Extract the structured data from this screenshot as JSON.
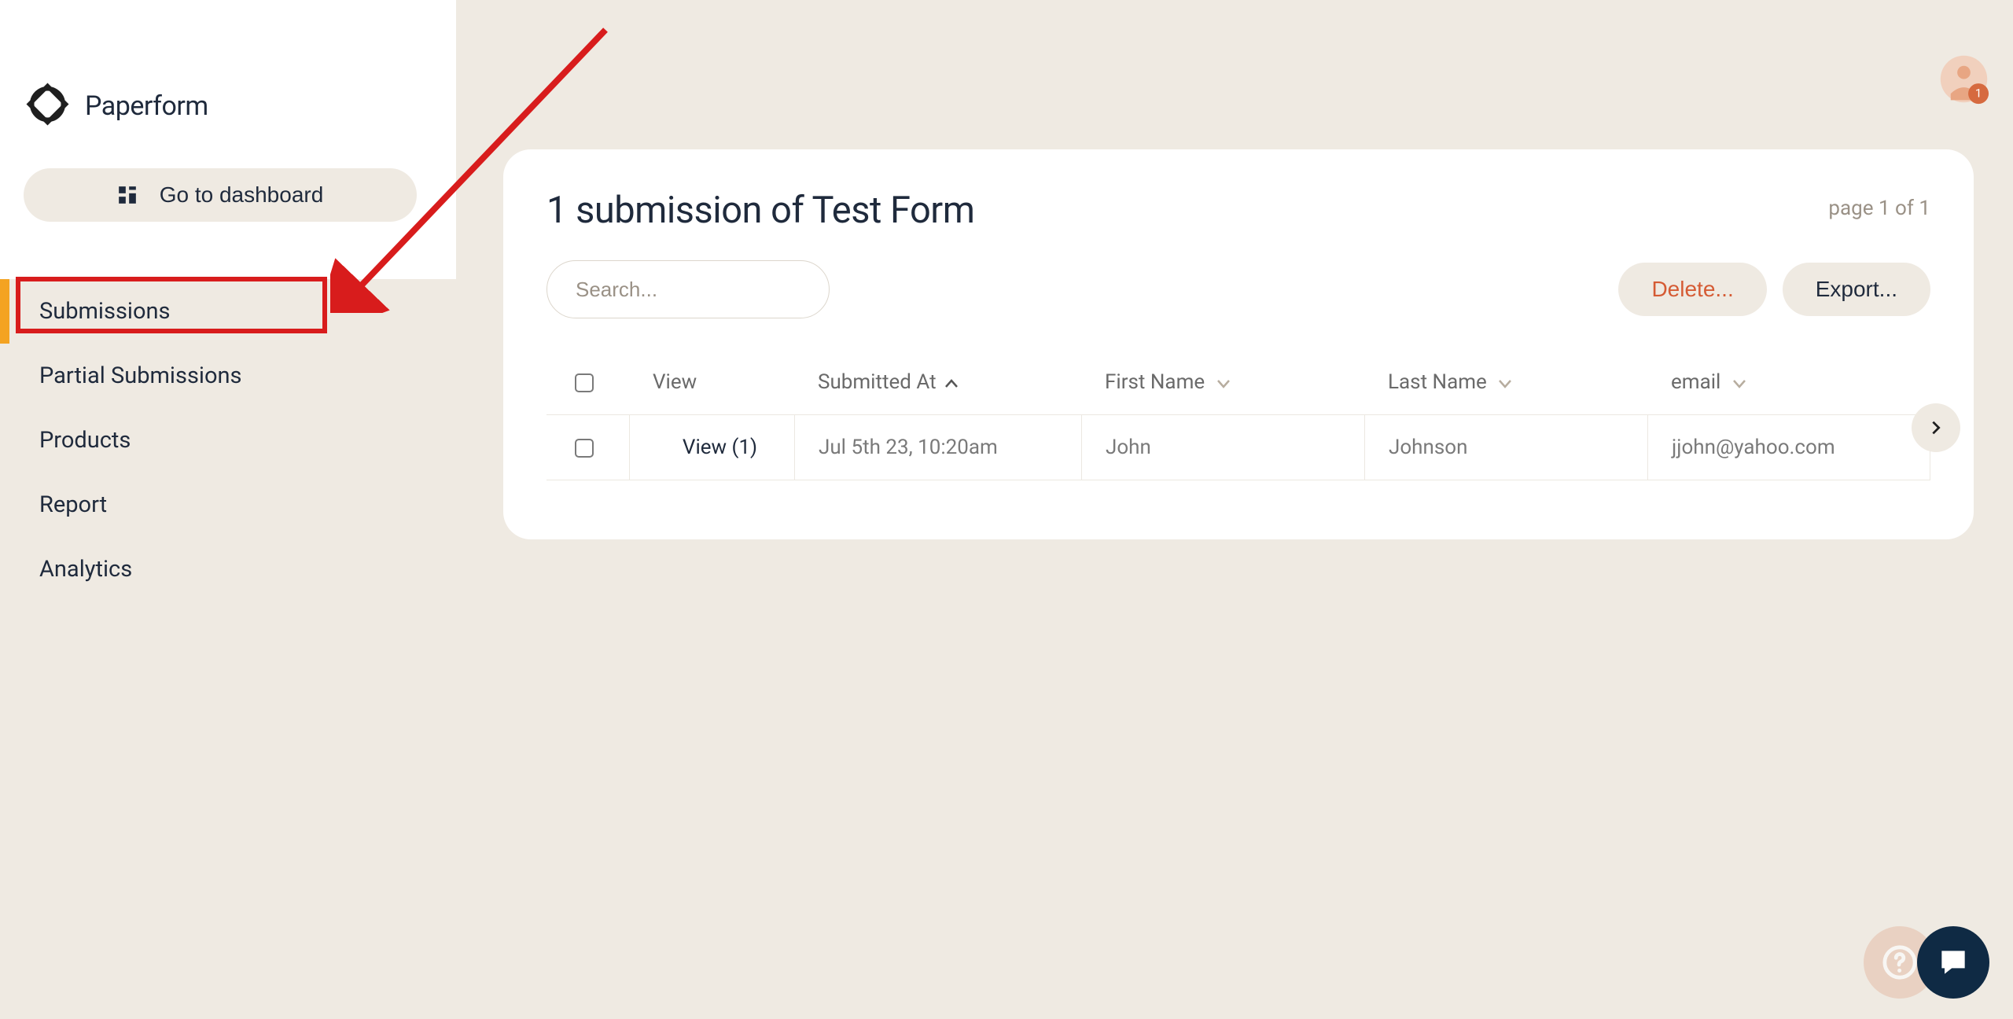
{
  "brand": {
    "name": "Paperform"
  },
  "sidebar": {
    "dashboard_label": "Go to dashboard",
    "items": [
      {
        "label": "Submissions",
        "active": true
      },
      {
        "label": "Partial Submissions",
        "active": false
      },
      {
        "label": "Products",
        "active": false
      },
      {
        "label": "Report",
        "active": false
      },
      {
        "label": "Analytics",
        "active": false
      }
    ]
  },
  "avatar": {
    "badge": "1"
  },
  "page": {
    "title": "1 submission of Test Form",
    "page_info": "page 1 of 1",
    "search_placeholder": "Search...",
    "delete_label": "Delete...",
    "export_label": "Export..."
  },
  "table": {
    "columns": {
      "view": "View",
      "submitted_at": "Submitted At",
      "first_name": "First Name",
      "last_name": "Last Name",
      "email": "email"
    },
    "rows": [
      {
        "view_label": "View (1)",
        "submitted_at": "Jul 5th 23, 10:20am",
        "first_name": "John",
        "last_name": "Johnson",
        "email": "jjohn@yahoo.com"
      }
    ]
  },
  "annotations": {
    "red_highlight_target": "Submissions",
    "arrow_points_to": "Submissions"
  }
}
